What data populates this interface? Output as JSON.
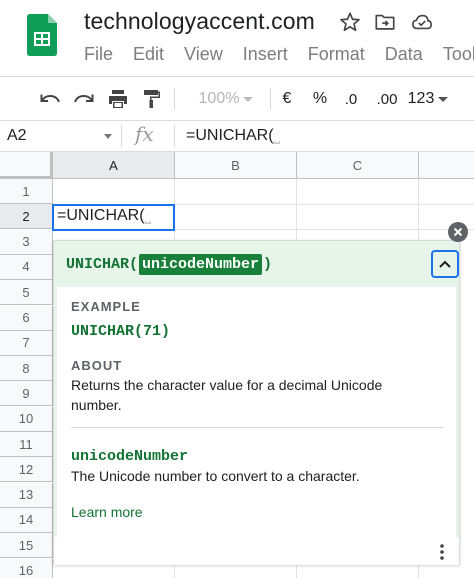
{
  "app": {
    "doc_title": "technologyaccent.com",
    "icons": [
      "sheets-logo-icon",
      "star-icon",
      "move-to-folder-icon",
      "cloud-status-icon"
    ]
  },
  "menu": [
    "File",
    "Edit",
    "View",
    "Insert",
    "Format",
    "Data",
    "Tools"
  ],
  "toolbar": {
    "zoom": "100%",
    "currency": "€",
    "percent": "%",
    "decrease_decimals": ".0",
    "increase_decimals": ".00",
    "more_formats": "123"
  },
  "formula_bar": {
    "name_box": "A2",
    "fx": "fx",
    "formula": "=UNICHAR(",
    "formula_hint": "⎵"
  },
  "grid": {
    "columns": [
      "A",
      "B",
      "C"
    ],
    "rows": [
      "1",
      "2",
      "3",
      "4",
      "5",
      "6",
      "7",
      "8",
      "9",
      "10",
      "11",
      "12",
      "13",
      "14",
      "15",
      "16"
    ],
    "active_cell": "A2",
    "active_cell_text": "=UNICHAR(",
    "active_cell_hint": "⎵"
  },
  "help_card": {
    "func_open": "UNICHAR(",
    "param": "unicodeNumber",
    "func_close": ")",
    "example_label": "EXAMPLE",
    "example": "UNICHAR(71)",
    "about_label": "ABOUT",
    "about_text": "Returns the character value for a decimal Unicode number.",
    "param_name": "unicodeNumber",
    "param_desc": "The Unicode number to convert to a character.",
    "learn_more": "Learn more"
  },
  "colors": {
    "accent_blue": "#1a73e8",
    "help_green": "#137333",
    "param_chip": "#188038",
    "help_header_bg": "#e6f4ea"
  }
}
